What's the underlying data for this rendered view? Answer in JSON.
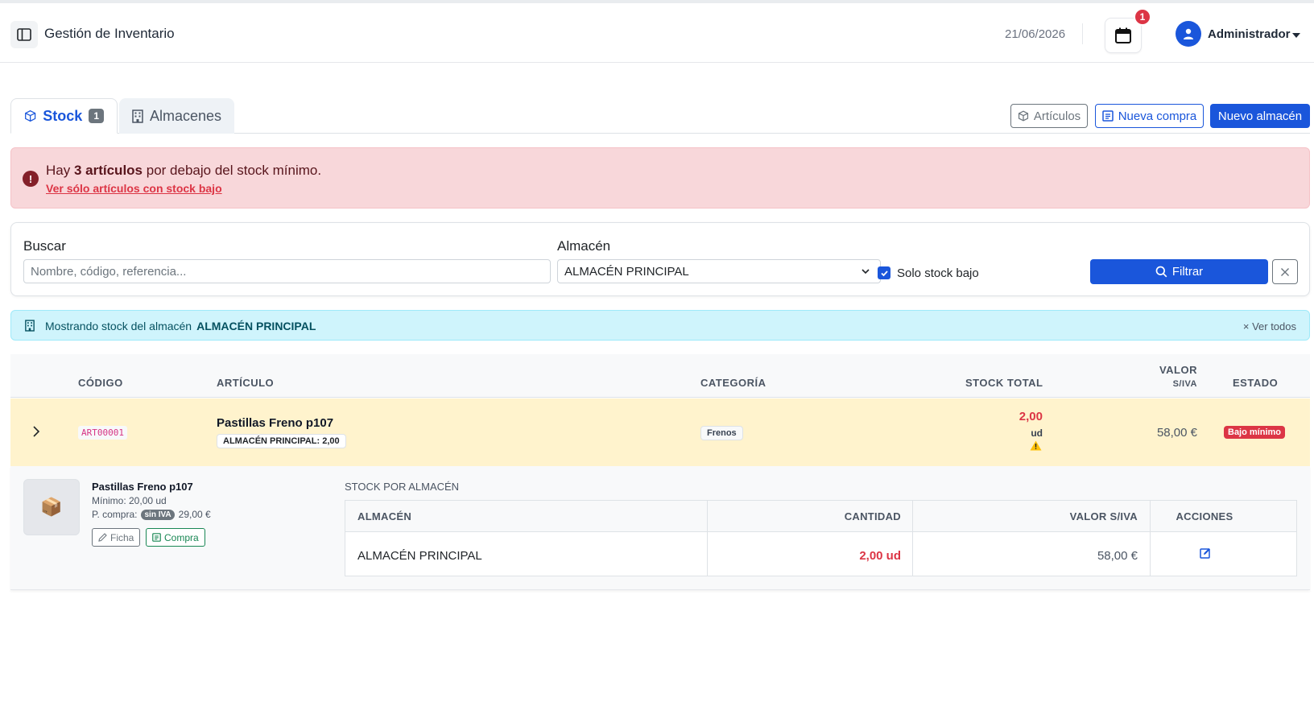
{
  "header": {
    "title": "Gestión de Inventario",
    "date": "21/06/2026",
    "notification_count": "1",
    "user_name": "Administrador"
  },
  "tabs": [
    {
      "label": "Stock",
      "badge": "1"
    },
    {
      "label": "Almacenes"
    }
  ],
  "actions": {
    "articulos": "Artículos",
    "nueva_compra": "Nueva compra",
    "nuevo_almacen": "Nuevo almacén"
  },
  "alert": {
    "prefix": "Hay",
    "bold": "3 artículos",
    "suffix": "por debajo del stock mínimo.",
    "link": "Ver sólo artículos con stock bajo"
  },
  "filters": {
    "search_label": "Buscar",
    "search_placeholder": "Nombre, código, referencia...",
    "search_value": "",
    "almacen_label": "Almacén",
    "almacen_value": "ALMACÉN PRINCIPAL",
    "solo_stock_bajo_label": "Solo stock bajo",
    "solo_stock_bajo_checked": true,
    "filter_button": "Filtrar"
  },
  "info_banner": {
    "text": "Mostrando stock del almacén",
    "almacen": "ALMACÉN PRINCIPAL",
    "ver_todos": "× Ver todos"
  },
  "table": {
    "headers": {
      "codigo": "CÓDIGO",
      "articulo": "ARTÍCULO",
      "categoria": "CATEGORÍA",
      "stock_total": "STOCK TOTAL",
      "valor_line1": "VALOR",
      "valor_line2": "S/IVA",
      "estado": "ESTADO"
    },
    "rows": [
      {
        "codigo": "ART00001",
        "articulo": "Pastillas Freno p107",
        "almacen_badge": "ALMACÉN PRINCIPAL: 2,00",
        "categoria": "Frenos",
        "stock": "2,00",
        "unidad": "ud",
        "valor": "58,00 €",
        "estado": "Bajo mínimo"
      }
    ]
  },
  "detail": {
    "name": "Pastillas Freno p107",
    "minimo": "Mínimo: 20,00 ud",
    "precio_label": "P. compra:",
    "sin_iva": "sin IVA",
    "precio": "29,00 €",
    "ficha_button": "Ficha",
    "compra_button": "Compra",
    "subtable_title": "STOCK POR ALMACÉN",
    "subtable_headers": {
      "almacen": "ALMACÉN",
      "cantidad": "CANTIDAD",
      "valor": "VALOR S/IVA",
      "acciones": "ACCIONES"
    },
    "subtable_rows": [
      {
        "almacen": "ALMACÉN PRINCIPAL",
        "cantidad": "2,00 ud",
        "valor": "58,00 €"
      }
    ]
  },
  "colors": {
    "primary": "#1a56db",
    "danger": "#dc3545",
    "warning_row": "#fff3cd",
    "alert_bg": "#f8d7da",
    "info_bg": "#cff4fc"
  }
}
